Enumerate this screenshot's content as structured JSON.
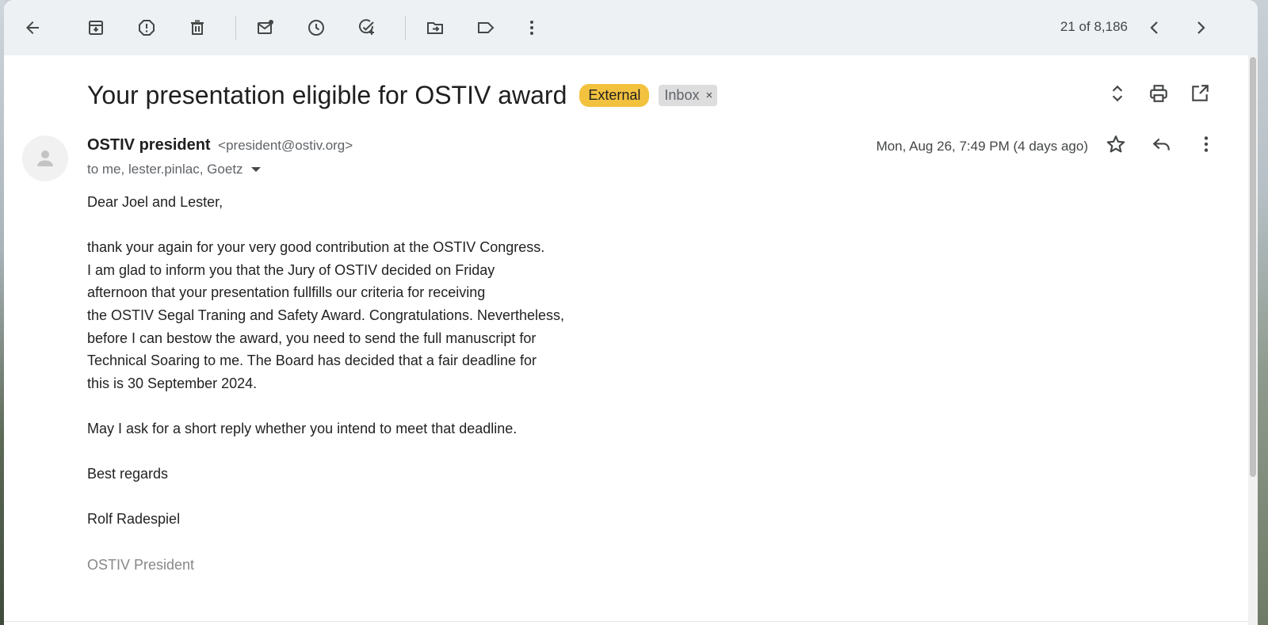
{
  "toolbar": {
    "icons": [
      "back-arrow-icon",
      "archive-icon",
      "report-spam-icon",
      "delete-icon",
      "mark-unread-icon",
      "snooze-icon",
      "add-task-icon",
      "move-to-icon",
      "label-icon",
      "more-vert-icon"
    ],
    "pager_text": "21 of 8,186"
  },
  "email": {
    "subject": "Your presentation eligible for OSTIV award",
    "labels": {
      "external": "External",
      "inbox": "Inbox",
      "inbox_remove": "×"
    },
    "sender": {
      "name": "OSTIV president",
      "email": "<president@ostiv.org>"
    },
    "recipients": "to me, lester.pinlac, Goetz",
    "date": "Mon, Aug 26, 7:49 PM (4 days ago)",
    "body": {
      "greeting": "Dear Joel and Lester,",
      "lines": [
        "thank your again for your very good contribution at the OSTIV Congress.",
        "I am glad to inform you that the Jury of OSTIV decided on Friday",
        "afternoon that your presentation fullfills our criteria for receiving",
        "the OSTIV Segal Traning and Safety Award. Congratulations. Nevertheless,",
        "before I can bestow the award, you need to send the full manuscript for",
        "Technical Soaring to me. The Board has decided that a fair deadline for",
        "this is 30 September 2024."
      ],
      "request": "May I ask for a short reply whether you intend to meet that deadline.",
      "closing": "Best regards",
      "signature_name": "Rolf Radespiel",
      "signature_title": "OSTIV President"
    }
  },
  "colors": {
    "external_chip": "#f2c23f",
    "inbox_chip": "#dddddd",
    "text_primary": "#1f1f1f",
    "text_secondary": "#5f6368"
  }
}
